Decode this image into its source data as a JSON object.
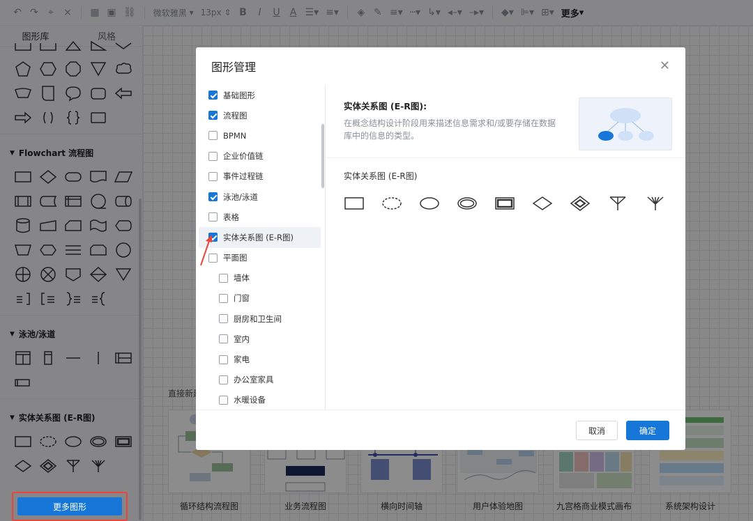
{
  "toolbar": {
    "icons": [
      "undo-icon",
      "redo-icon",
      "format-painter-icon",
      "clear-format-icon",
      "bg-pattern-icon",
      "image-icon",
      "link-icon"
    ],
    "font_family": "微软雅黑",
    "font_size": "13px",
    "more_label": "更多"
  },
  "sidebar": {
    "tabs": [
      {
        "label": "图形库"
      },
      {
        "label": "风格"
      }
    ],
    "sections": [
      {
        "title": "Flowchart 流程图"
      },
      {
        "title": "泳池/泳道"
      },
      {
        "title": "实体关系图 (E-R图)"
      }
    ],
    "more_shapes_label": "更多图形"
  },
  "canvas": {
    "direct_new_label": "直接新建",
    "templates": [
      {
        "name": "循环结构流程图"
      },
      {
        "name": "业务流程图"
      },
      {
        "name": "横向时间轴"
      },
      {
        "name": "用户体验地图"
      },
      {
        "name": "九宫格商业模式画布"
      },
      {
        "name": "系统架构设计"
      }
    ]
  },
  "dialog": {
    "title": "图形管理",
    "close_icon": "close-icon",
    "categories": [
      {
        "label": "基础图形",
        "checked": true,
        "sub": false
      },
      {
        "label": "流程图",
        "checked": true,
        "sub": false
      },
      {
        "label": "BPMN",
        "checked": false,
        "sub": false
      },
      {
        "label": "企业价值链",
        "checked": false,
        "sub": false
      },
      {
        "label": "事件过程链",
        "checked": false,
        "sub": false
      },
      {
        "label": "泳池/泳道",
        "checked": true,
        "sub": false
      },
      {
        "label": "表格",
        "checked": false,
        "sub": false
      },
      {
        "label": "实体关系图 (E-R图)",
        "checked": true,
        "sub": false,
        "highlighted": true
      },
      {
        "label": "平面图",
        "checked": false,
        "sub": false
      },
      {
        "label": "墙体",
        "checked": false,
        "sub": true
      },
      {
        "label": "门窗",
        "checked": false,
        "sub": true
      },
      {
        "label": "厨房和卫生间",
        "checked": false,
        "sub": true
      },
      {
        "label": "室内",
        "checked": false,
        "sub": true
      },
      {
        "label": "家电",
        "checked": false,
        "sub": true
      },
      {
        "label": "办公室家具",
        "checked": false,
        "sub": true
      },
      {
        "label": "水暖设备",
        "checked": false,
        "sub": true
      }
    ],
    "detail": {
      "title": "实体关系图 (E-R图):",
      "description": "在概念结构设计阶段用来描述信息需求和/或要存储在数据库中的信息的类型。",
      "section_label": "实体关系图 (E-R图)",
      "shapes": [
        "rectangle-entity",
        "dashed-ellipse-attribute",
        "ellipse-attribute",
        "double-ellipse-attribute",
        "double-rectangle-entity",
        "diamond-relationship",
        "double-diamond-relationship",
        "crowfoot-one",
        "crowfoot-many"
      ]
    },
    "cancel_label": "取消",
    "ok_label": "确定"
  },
  "colors": {
    "accent": "#1677d9",
    "annotation": "#e8463a"
  }
}
